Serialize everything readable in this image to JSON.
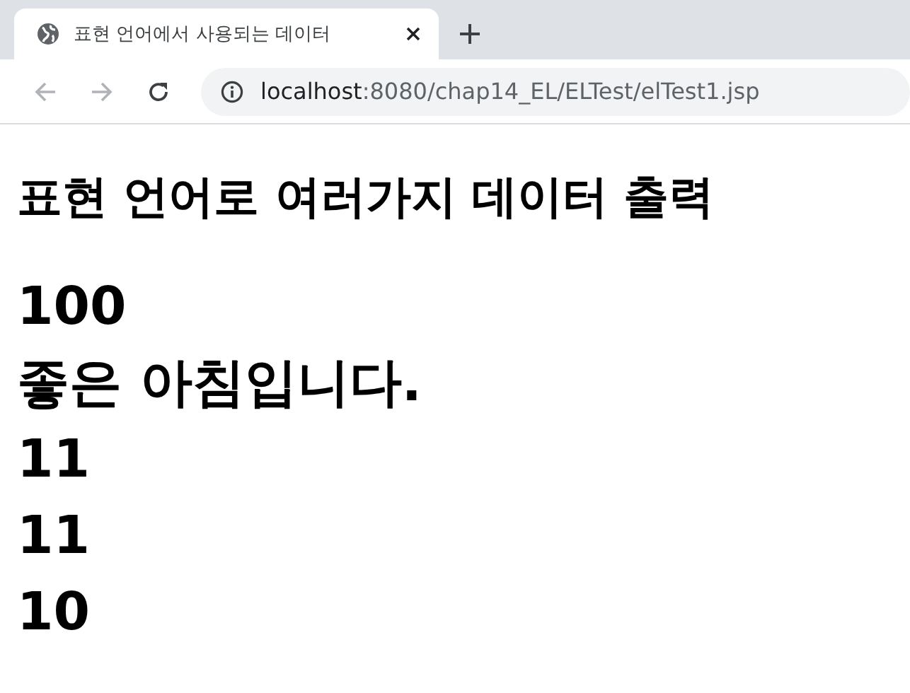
{
  "tab": {
    "title": "표현 언어에서 사용되는 데이터",
    "selected": true
  },
  "address_bar": {
    "host": "localhost",
    "path": ":8080/chap14_EL/ELTest/elTest1.jsp"
  },
  "page": {
    "heading": "표현 언어로 여러가지 데이터 출력",
    "lines": [
      "100",
      "좋은 아침입니다.",
      "11",
      "11",
      "10"
    ]
  }
}
